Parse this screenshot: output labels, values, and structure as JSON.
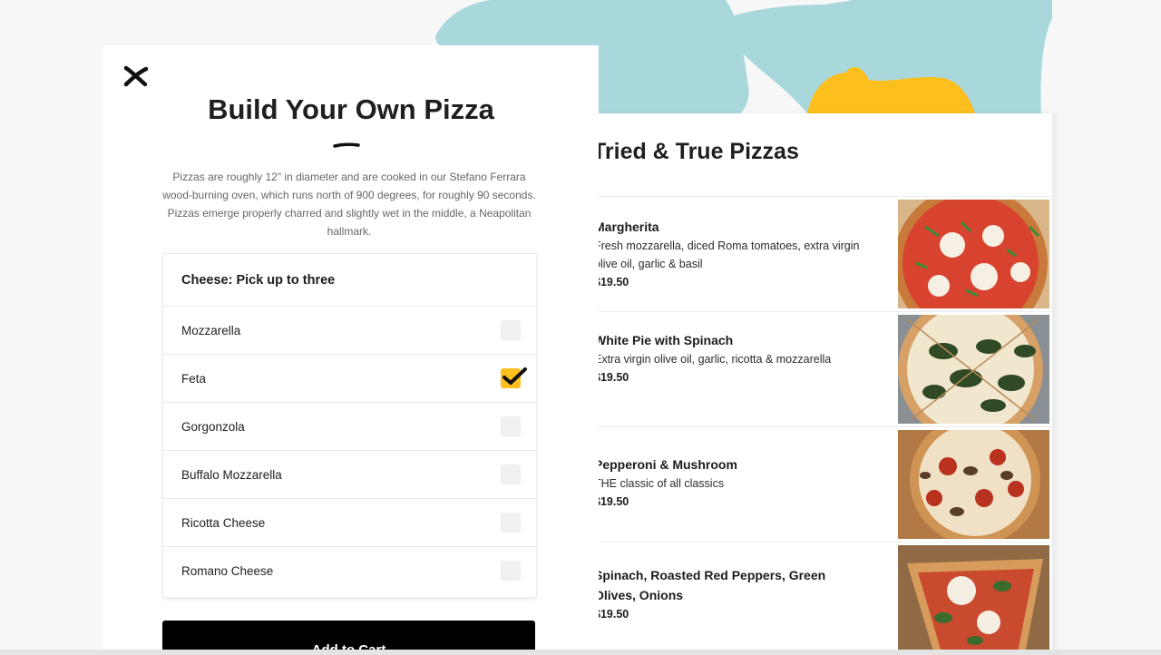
{
  "background": {
    "section_title": "Tried & True Pizzas",
    "pizzas": [
      {
        "name": "Margherita",
        "description": "Fresh mozzarella, diced Roma tomatoes, extra virgin olive oil, garlic & basil",
        "price": "$19.50",
        "image": "margherita-photo"
      },
      {
        "name": "White Pie with Spinach",
        "description": "Extra virgin olive oil, garlic, ricotta & mozzarella",
        "price": "$19.50",
        "image": "white-pie-spinach-photo"
      },
      {
        "name": "Pepperoni & Mushroom",
        "description": "THE classic of all classics",
        "price": "$19.50",
        "image": "pepperoni-mushroom-photo"
      },
      {
        "name": "Spinach, Roasted Red Peppers, Green Olives, Onions",
        "description": "",
        "price": "$19.50",
        "image": "spinach-peppers-photo"
      }
    ]
  },
  "modal": {
    "close_icon": "close-x-icon",
    "title": "Build Your Own Pizza",
    "description": "Pizzas are roughly 12\" in diameter and are cooked in our Stefano Ferrara wood-burning oven, which runs north of 900 degrees, for roughly 90 seconds. Pizzas emerge properly charred and slightly wet in the middle, a Neapolitan hallmark.",
    "options_header": "Cheese: Pick up to three",
    "options": [
      {
        "label": "Mozzarella",
        "checked": false
      },
      {
        "label": "Feta",
        "checked": true
      },
      {
        "label": "Gorgonzola",
        "checked": false
      },
      {
        "label": "Buffalo Mozzarella",
        "checked": false
      },
      {
        "label": "Ricotta Cheese",
        "checked": false
      },
      {
        "label": "Romano Cheese",
        "checked": false
      }
    ],
    "add_to_cart_label": "Add to Cart"
  },
  "colors": {
    "accent_yellow": "#fcbf1e",
    "blob_blue": "#a9d8dc",
    "button_black": "#000000"
  }
}
